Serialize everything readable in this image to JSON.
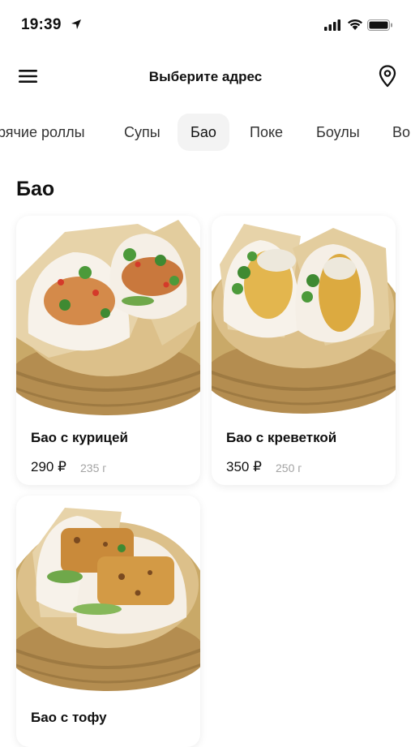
{
  "status": {
    "time": "19:39"
  },
  "header": {
    "title": "Выберите адрес"
  },
  "tabs": [
    {
      "label": "рячие роллы"
    },
    {
      "label": "Супы"
    },
    {
      "label": "Бао"
    },
    {
      "label": "Поке"
    },
    {
      "label": "Боулы"
    },
    {
      "label": "Во"
    }
  ],
  "active_tab": "Бао",
  "section": {
    "title": "Бао"
  },
  "products": [
    {
      "name": "Бао с курицей",
      "price": "290 ₽",
      "weight": "235 г"
    },
    {
      "name": "Бао с креветкой",
      "price": "350 ₽",
      "weight": "250 г"
    },
    {
      "name": "Бао с тофу"
    }
  ],
  "icons": {
    "menu": "hamburger-icon",
    "location": "map-pin-icon"
  },
  "colors": {
    "bamboo": "#c9a968",
    "bun": "#f7f2ea",
    "herb": "#3f8a32",
    "active_tab_bg": "#f3f3f3"
  }
}
